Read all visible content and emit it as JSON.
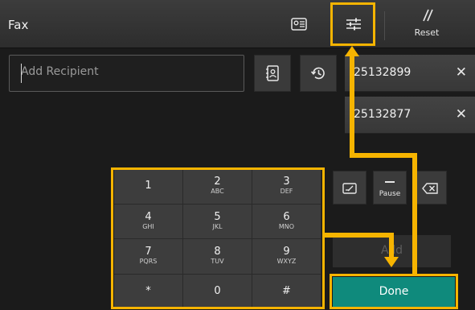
{
  "header": {
    "title": "Fax",
    "icons": {
      "address_book": "address-card-icon",
      "settings": "sliders-icon",
      "reset": "reset-slash-icon"
    },
    "reset_label": "Reset"
  },
  "recipient": {
    "placeholder": "Add Recipient",
    "address_book_icon": "contacts-book-icon",
    "history_icon": "history-clock-icon",
    "list": [
      {
        "number": "25132899",
        "remove": "✕"
      },
      {
        "number": "25132877",
        "remove": "✕"
      }
    ]
  },
  "keypad": {
    "keys": [
      {
        "n": "1",
        "l": ""
      },
      {
        "n": "2",
        "l": "ABC"
      },
      {
        "n": "3",
        "l": "DEF"
      },
      {
        "n": "4",
        "l": "GHI"
      },
      {
        "n": "5",
        "l": "JKL"
      },
      {
        "n": "6",
        "l": "MNO"
      },
      {
        "n": "7",
        "l": "PQRS"
      },
      {
        "n": "8",
        "l": "TUV"
      },
      {
        "n": "9",
        "l": "WXYZ"
      },
      {
        "n": "*",
        "l": ""
      },
      {
        "n": "0",
        "l": ""
      },
      {
        "n": "#",
        "l": ""
      }
    ]
  },
  "side_buttons": {
    "pause_label": "Pause"
  },
  "actions": {
    "add_label": "Add",
    "done_label": "Done"
  },
  "colors": {
    "highlight": "#f6b400",
    "done": "#0f8a7c",
    "background": "#1b1b1b"
  }
}
